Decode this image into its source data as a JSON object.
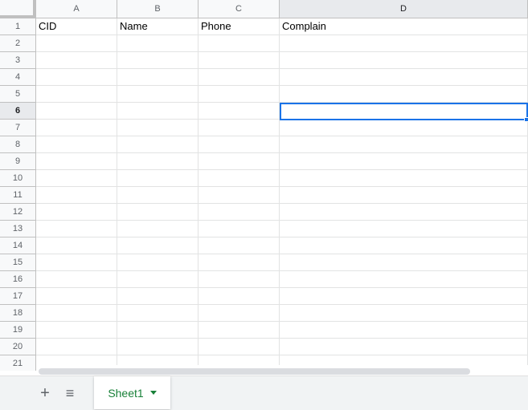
{
  "columns": [
    "A",
    "B",
    "C",
    "D"
  ],
  "active_column": "D",
  "rows": [
    "1",
    "2",
    "3",
    "4",
    "5",
    "6",
    "7",
    "8",
    "9",
    "10",
    "11",
    "12",
    "13",
    "14",
    "15",
    "16",
    "17",
    "18",
    "19",
    "20",
    "21"
  ],
  "active_row": "6",
  "header_cells": {
    "A1": "CID",
    "B1": "Name",
    "C1": "Phone",
    "D1": "Complain"
  },
  "selected_cell": "D6",
  "tabbar": {
    "add_sheet": "+",
    "all_sheets": "≡",
    "sheets": [
      {
        "label": "Sheet1",
        "active": true
      }
    ]
  },
  "colors": {
    "accent": "#1a73e8",
    "tab_active_text": "#188038"
  }
}
